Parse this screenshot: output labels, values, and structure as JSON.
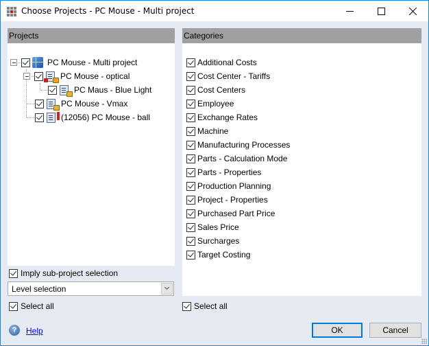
{
  "window": {
    "title": "Choose Projects - PC Mouse - Multi project",
    "controls": {
      "minimize": "minimize",
      "maximize": "maximize",
      "close": "close"
    }
  },
  "projects": {
    "header": "Projects",
    "tree": [
      {
        "label": "PC Mouse - Multi project",
        "checked": true,
        "level": 0,
        "expanded": true,
        "icon": "multi-project-icon"
      },
      {
        "label": "PC Mouse - optical",
        "checked": true,
        "level": 1,
        "expanded": true,
        "icon": "locked-project-icon"
      },
      {
        "label": "PC Maus - Blue Light",
        "checked": true,
        "level": 2,
        "icon": "locked-project-icon"
      },
      {
        "label": "PC Mouse - Vmax",
        "checked": true,
        "level": 1,
        "icon": "locked-project-icon"
      },
      {
        "label": "(12056) PC Mouse - ball",
        "checked": true,
        "level": 1,
        "icon": "flagged-project-icon"
      }
    ],
    "imply_sub_project": {
      "label": "Imply sub-project selection",
      "checked": true
    },
    "level_select": {
      "value": "Level selection"
    },
    "select_all": {
      "label": "Select all",
      "checked": true
    }
  },
  "categories": {
    "header": "Categories",
    "items": [
      {
        "label": "Additional Costs",
        "checked": true
      },
      {
        "label": "Cost Center - Tariffs",
        "checked": true
      },
      {
        "label": "Cost Centers",
        "checked": true
      },
      {
        "label": "Employee",
        "checked": true
      },
      {
        "label": "Exchange Rates",
        "checked": true
      },
      {
        "label": "Machine",
        "checked": true
      },
      {
        "label": "Manufacturing Processes",
        "checked": true
      },
      {
        "label": "Parts - Calculation Mode",
        "checked": true
      },
      {
        "label": "Parts - Properties",
        "checked": true
      },
      {
        "label": "Production Planning",
        "checked": true
      },
      {
        "label": "Project - Properties",
        "checked": true
      },
      {
        "label": "Purchased Part Price",
        "checked": true
      },
      {
        "label": "Sales Price",
        "checked": true
      },
      {
        "label": "Surcharges",
        "checked": true
      },
      {
        "label": "Target Costing",
        "checked": true
      }
    ],
    "select_all": {
      "label": "Select all",
      "checked": true
    }
  },
  "footer": {
    "help_label": "Help",
    "ok_label": "OK",
    "cancel_label": "Cancel"
  }
}
